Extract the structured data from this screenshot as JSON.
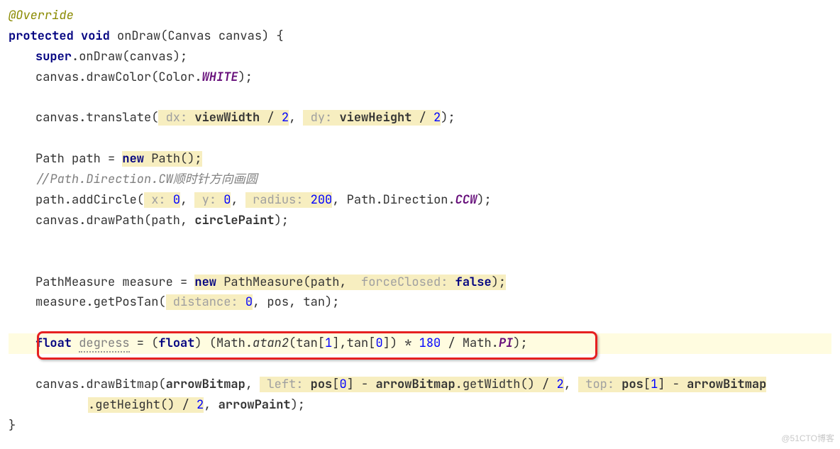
{
  "annotation": "@Override",
  "sig": {
    "protected": "protected",
    "void": "void",
    "method": "onDraw",
    "params": "(Canvas canvas) {"
  },
  "l1": {
    "super": "super",
    "tail": ".onDraw(canvas);"
  },
  "l2": {
    "head": "canvas.drawColor(Color.",
    "const": "WHITE",
    "tail": ");"
  },
  "l3": {
    "head": "canvas.translate(",
    "h1": " dx: ",
    "v1": "viewWidth",
    "op1": " / ",
    "n1": "2",
    "c1": ", ",
    "h2": " dy: ",
    "v2": "viewHeight",
    "op2": " / ",
    "n2": "2",
    "tail": ");"
  },
  "l4": {
    "head": "Path path = ",
    "new": "new",
    "tail": " Path();"
  },
  "l5": {
    "comment": "//Path.Direction.CW顺时针方向画圆"
  },
  "l6": {
    "head": "path.addCircle(",
    "h1": " x: ",
    "n1": "0",
    "c1": ", ",
    "h2": " y: ",
    "n2": "0",
    "c2": ", ",
    "h3": " radius: ",
    "n3": "200",
    "c3": ", Path.Direction.",
    "const": "CCW",
    "tail": ");"
  },
  "l7": {
    "head": "canvas.drawPath(path, ",
    "b": "circlePaint",
    "tail": ");"
  },
  "l8": {
    "head": "PathMeasure measure = ",
    "new": "new",
    "ctor": " PathMeasure(path, ",
    "h1": " forceClosed: ",
    "kw": "false",
    "tail": ");"
  },
  "l9": {
    "head": "measure.getPosTan(",
    "h1": " distance: ",
    "n1": "0",
    "c1": ", pos, tan);"
  },
  "l10": {
    "float": "float",
    "sp": " ",
    "var": "degress",
    "eq": " = (",
    "cast": "float",
    "mid": ") (Math.",
    "atan": "atan2",
    "args": "(tan[",
    "i1": "1",
    "m1": "],tan[",
    "i0": "0",
    "m2": "]) * ",
    "n180": "180",
    "m3": " / Math.",
    "pi": "PI",
    "tail": ");"
  },
  "l11a": {
    "head": "canvas.drawBitmap(",
    "b1": "arrowBitmap",
    "c1": ", ",
    "h1": " left: ",
    "p0": "pos",
    "br0": "[",
    "i0": "0",
    "brc": "] - ",
    "b2": "arrowBitmap",
    "gw": ".getWidth() / ",
    "n2": "2",
    "c2": ", ",
    "h2": " top: ",
    "p1": "pos",
    "br1": "[",
    "i1": "1",
    "brc1": "] - ",
    "b3": "arrowBitmap"
  },
  "l11b": {
    "gh": ".getHeight() / ",
    "n2": "2",
    "c": ", ",
    "ap": "arrowPaint",
    "tail": ");"
  },
  "closeBrace": "}",
  "watermark": "@51CTO博客"
}
